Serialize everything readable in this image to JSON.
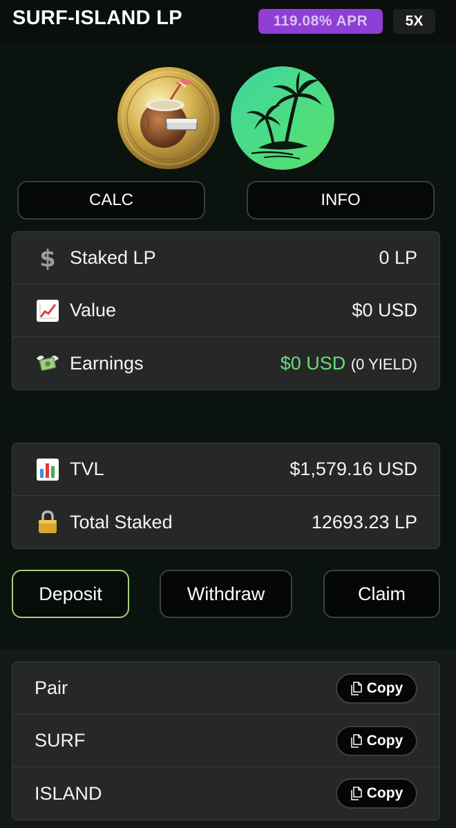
{
  "header": {
    "title": "SURF-ISLAND LP",
    "apr_badge": "119.08% APR",
    "multiplier_badge": "5X"
  },
  "tokens": [
    {
      "name": "SURF",
      "icon": "coconut-coin-icon"
    },
    {
      "name": "ISLAND",
      "icon": "palm-island-icon"
    }
  ],
  "top_buttons": {
    "calc_label": "CALC",
    "info_label": "INFO"
  },
  "stats": {
    "staked_lp": {
      "icon": "dollar-sign-icon",
      "label": "Staked LP",
      "value": "0 LP"
    },
    "value": {
      "icon": "chart-increasing-icon",
      "label": "Value",
      "value": "$0 USD"
    },
    "earnings": {
      "icon": "money-with-wings-icon",
      "label": "Earnings",
      "value": "$0 USD",
      "yield": "(0 YIELD)"
    }
  },
  "pool": {
    "tvl": {
      "icon": "bar-chart-icon",
      "label": "TVL",
      "value": "$1,579.16 USD"
    },
    "total_staked": {
      "icon": "lock-icon",
      "label": "Total Staked",
      "value": "12693.23 LP"
    }
  },
  "actions": {
    "deposit_label": "Deposit",
    "withdraw_label": "Withdraw",
    "claim_label": "Claim"
  },
  "addresses": [
    {
      "label": "Pair",
      "copy_label": "Copy"
    },
    {
      "label": "SURF",
      "copy_label": "Copy"
    },
    {
      "label": "ISLAND",
      "copy_label": "Copy"
    }
  ],
  "colors": {
    "apr_badge": "#8f3fd6",
    "earnings_green": "#6bdc7d",
    "deposit_border": "#a7cf7c",
    "island_gradient_start": "#3fd6a0",
    "island_gradient_end": "#58e06a"
  }
}
